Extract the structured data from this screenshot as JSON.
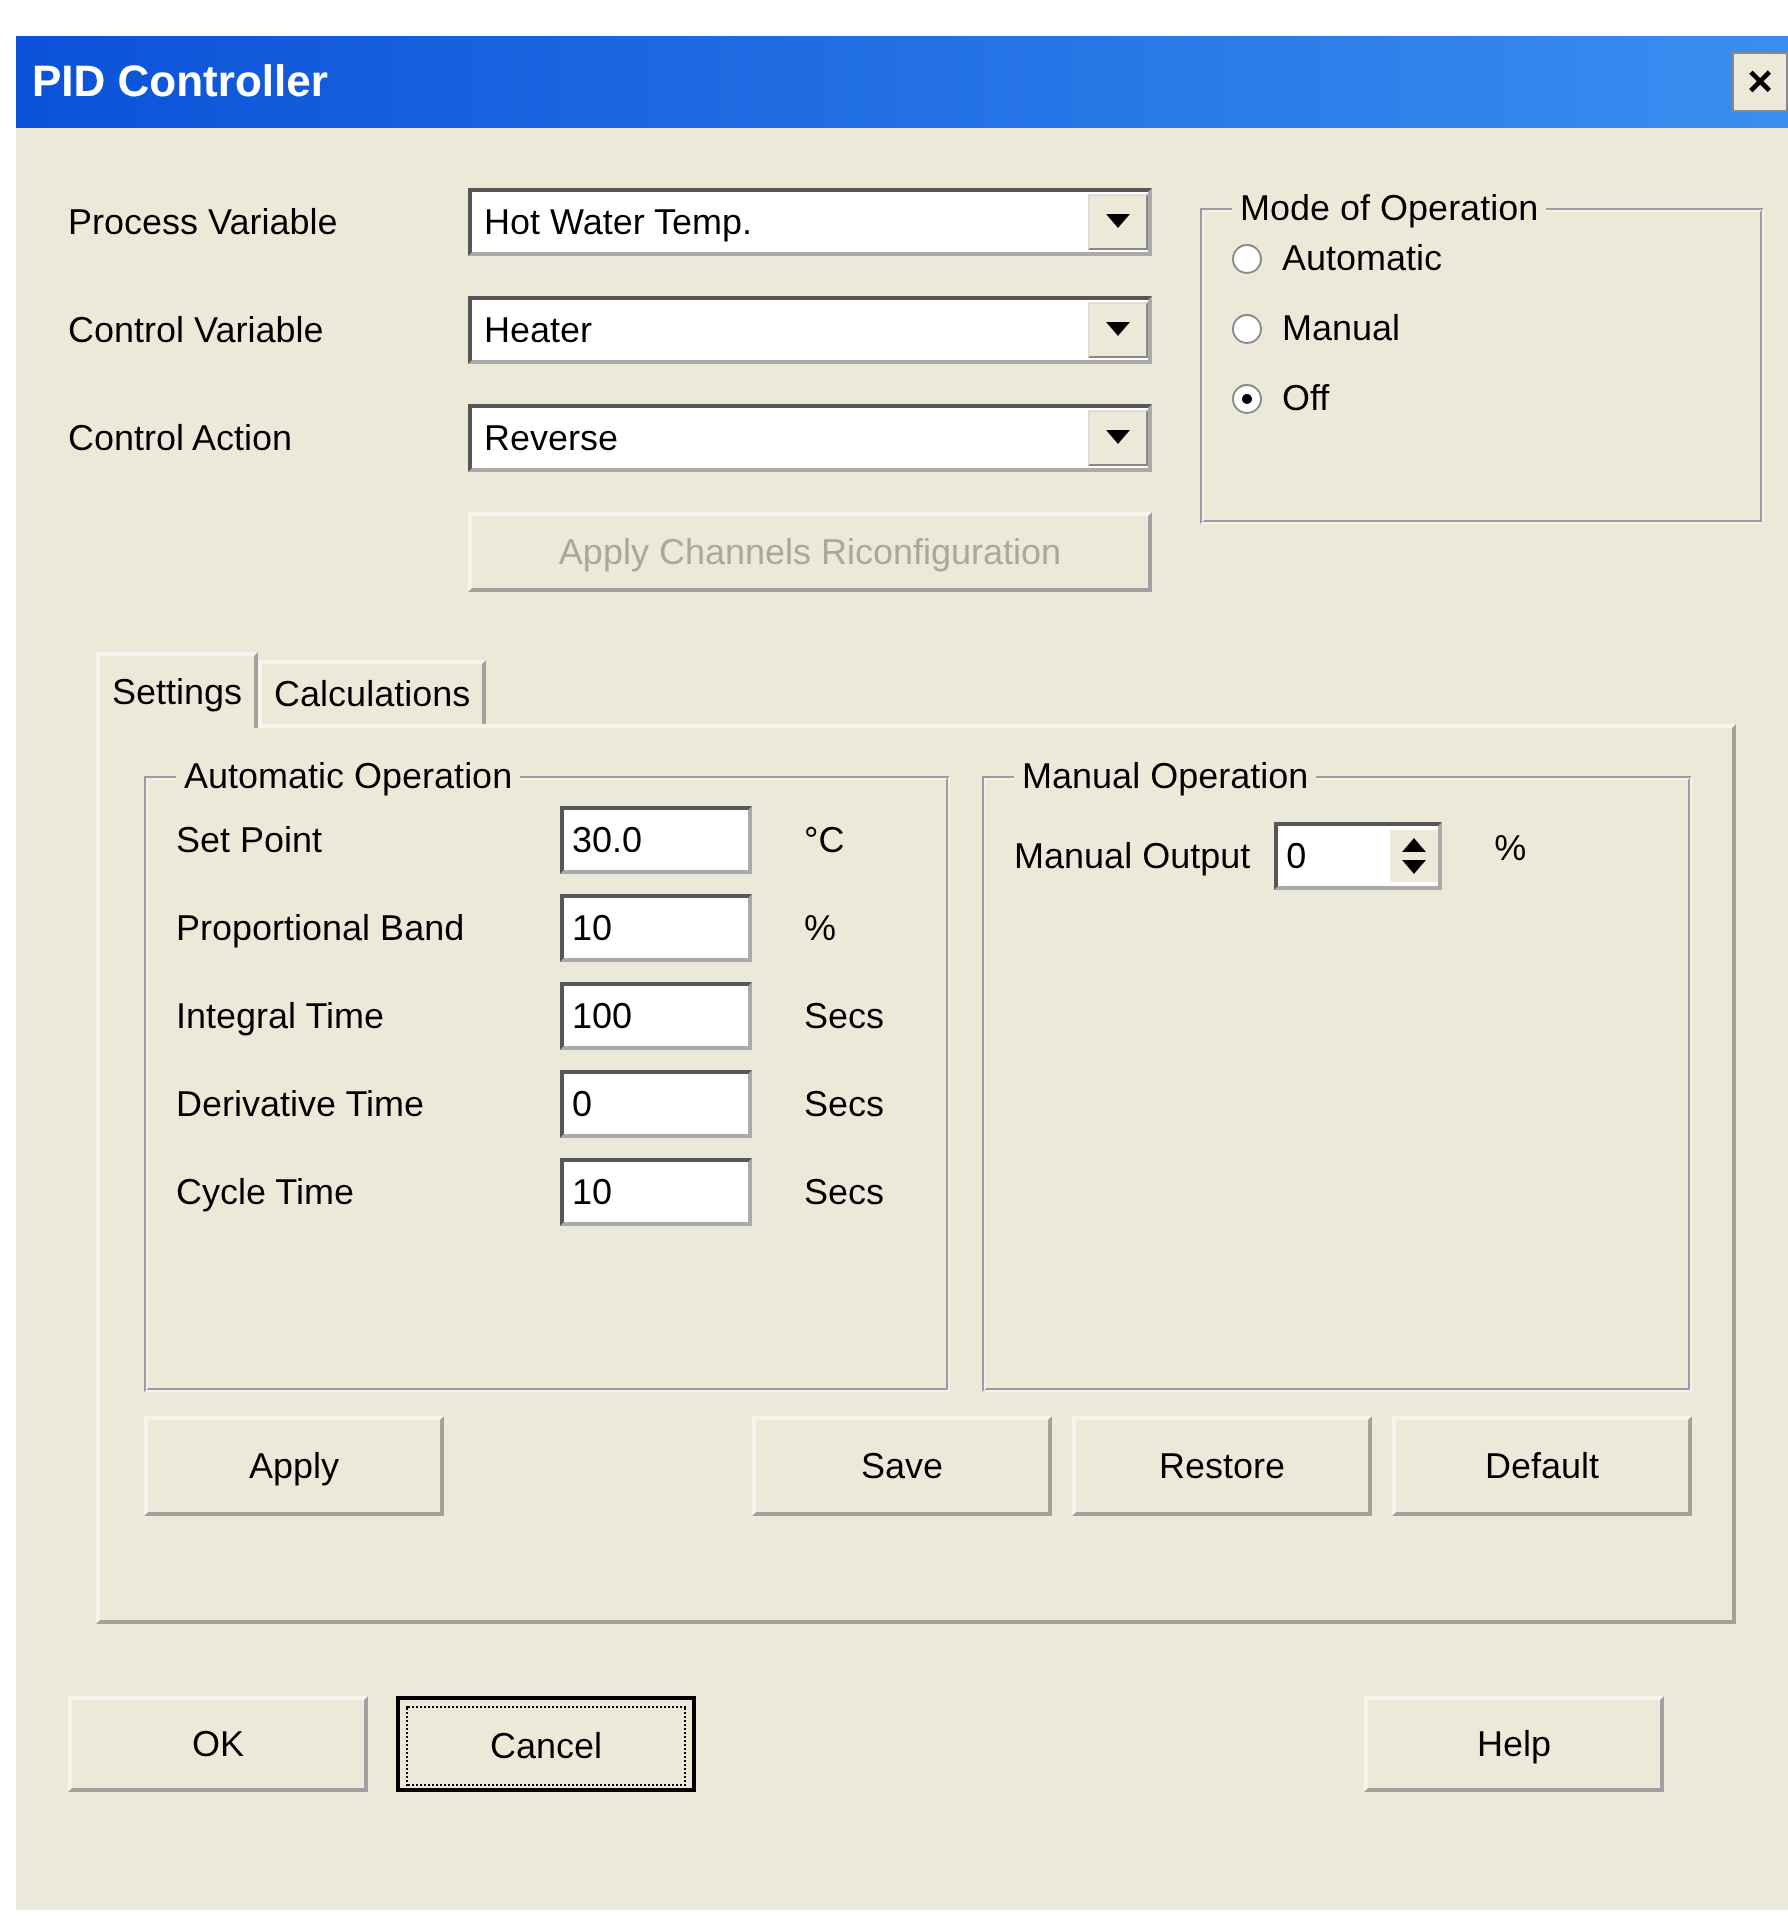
{
  "window": {
    "title": "PID Controller",
    "close": "×"
  },
  "selectors": [
    {
      "label": "Process Variable",
      "value": "Hot Water Temp."
    },
    {
      "label": "Control Variable",
      "value": "Heater"
    },
    {
      "label": "Control Action",
      "value": "Reverse"
    }
  ],
  "apply_channels_button": {
    "label": "Apply Channels Riconfiguration",
    "disabled": true
  },
  "mode": {
    "title": "Mode of Operation",
    "options": [
      {
        "label": "Automatic",
        "selected": false
      },
      {
        "label": "Manual",
        "selected": false
      },
      {
        "label": "Off",
        "selected": true
      }
    ]
  },
  "tabs": [
    {
      "label": "Settings",
      "selected": true
    },
    {
      "label": "Calculations",
      "selected": false
    }
  ],
  "automatic": {
    "title": "Automatic Operation",
    "fields": [
      {
        "label": "Set Point",
        "value": "30.0",
        "unit": "°C"
      },
      {
        "label": "Proportional Band",
        "value": "10",
        "unit": "%"
      },
      {
        "label": "Integral Time",
        "value": "100",
        "unit": "Secs"
      },
      {
        "label": "Derivative Time",
        "value": "0",
        "unit": "Secs"
      },
      {
        "label": "Cycle Time",
        "value": "10",
        "unit": "Secs"
      }
    ]
  },
  "manual": {
    "title": "Manual Operation",
    "label": "Manual Output",
    "value": "0",
    "unit": "%"
  },
  "tab_buttons": [
    "Apply",
    "Save",
    "Restore",
    "Default"
  ],
  "dialog_buttons": [
    {
      "label": "OK",
      "focused": false
    },
    {
      "label": "Cancel",
      "focused": true
    },
    {
      "label": "Help",
      "focused": false
    }
  ]
}
